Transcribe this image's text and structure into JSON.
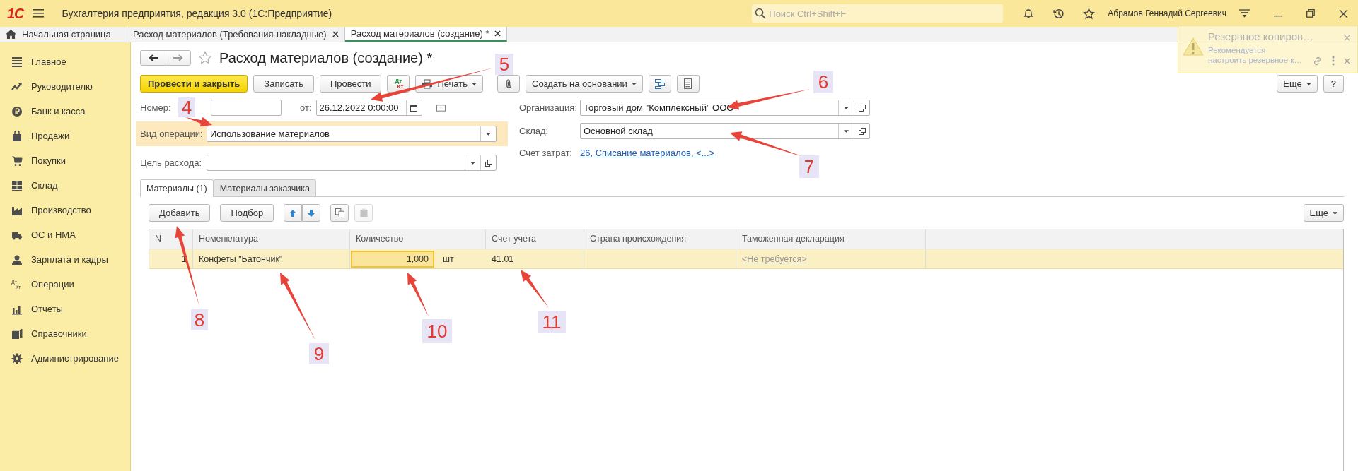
{
  "title_bar": {
    "logo": "1С",
    "app_title": "Бухгалтерия предприятия, редакция 3.0 (1С:Предприятие)",
    "search": {
      "placeholder": "Поиск Ctrl+Shift+F"
    },
    "user": "Абрамов Геннадий Сергеевич"
  },
  "tabs": [
    {
      "label": "Начальная страница",
      "kind": "home",
      "selected": false
    },
    {
      "label": "Расход материалов (Требования-накладные)",
      "kind": "doc",
      "selected": false
    },
    {
      "label": "Расход материалов (создание) *",
      "kind": "doc",
      "selected": true
    }
  ],
  "notification": {
    "title": "Резервное копиров…",
    "text_lines": [
      "Рекомендуется",
      "настроить резервное к…"
    ]
  },
  "sidebar": {
    "items": [
      {
        "label": "Главное"
      },
      {
        "label": "Руководителю"
      },
      {
        "label": "Банк и касса"
      },
      {
        "label": "Продажи"
      },
      {
        "label": "Покупки"
      },
      {
        "label": "Склад"
      },
      {
        "label": "Производство"
      },
      {
        "label": "ОС и НМА"
      },
      {
        "label": "Зарплата и кадры"
      },
      {
        "label": "Операции",
        "icon_top": "Дт",
        "icon_bottom": "Кт"
      },
      {
        "label": "Отчеты"
      },
      {
        "label": "Справочники"
      },
      {
        "label": "Администрирование"
      }
    ]
  },
  "form": {
    "title": "Расход материалов (создание) *",
    "toolbar": [
      {
        "kind": "primary",
        "label": "Провести и закрыть"
      },
      {
        "kind": "plain",
        "label": "Записать"
      },
      {
        "kind": "plain",
        "label": "Провести"
      },
      {
        "kind": "dtkt",
        "top": "Дт",
        "bottom": "Кт"
      },
      {
        "kind": "print",
        "label": "Печать"
      },
      {
        "kind": "attach"
      },
      {
        "kind": "menu",
        "label": "Создать на основании"
      },
      {
        "kind": "structure"
      },
      {
        "kind": "report"
      }
    ],
    "more": "Еще",
    "help": "?",
    "number": {
      "label": "Номер:"
    },
    "date": {
      "label": "от:",
      "value": "26.12.2022 0:00:00"
    },
    "operation": {
      "label": "Вид операции:",
      "value": "Использование материалов",
      "highlighted": true
    },
    "purpose": {
      "label": "Цель расхода:"
    },
    "organization": {
      "label": "Организация:",
      "value": "Торговый дом \"Комплексный\" ООО"
    },
    "warehouse": {
      "label": "Склад:",
      "value": "Основной склад"
    },
    "cost_account": {
      "label": "Счет затрат:",
      "link": "26, Списание материалов, <...>"
    },
    "sub_tabs": [
      {
        "label": "Материалы (1)",
        "selected": true
      },
      {
        "label": "Материалы заказчика",
        "selected": false
      }
    ],
    "table_toolbar": {
      "add": "Добавить",
      "pick": "Подбор",
      "more": "Еще",
      "paste_disabled": true
    },
    "table": {
      "columns": [
        "N",
        "Номенклатура",
        "Количество",
        "Счет учета",
        "Страна происхождения",
        "Таможенная декларация"
      ],
      "rows": [
        {
          "n": "1",
          "item": "Конфеты \"Батончик\"",
          "quantity": "1,000",
          "unit": "шт",
          "account": "41.01",
          "declaration": "<Не требуется>",
          "selected": true
        }
      ]
    }
  },
  "annotations": [
    {
      "label": "4"
    },
    {
      "label": "5"
    },
    {
      "label": "6"
    },
    {
      "label": "7"
    },
    {
      "label": "8"
    },
    {
      "label": "9"
    },
    {
      "label": "10"
    },
    {
      "label": "11"
    }
  ]
}
